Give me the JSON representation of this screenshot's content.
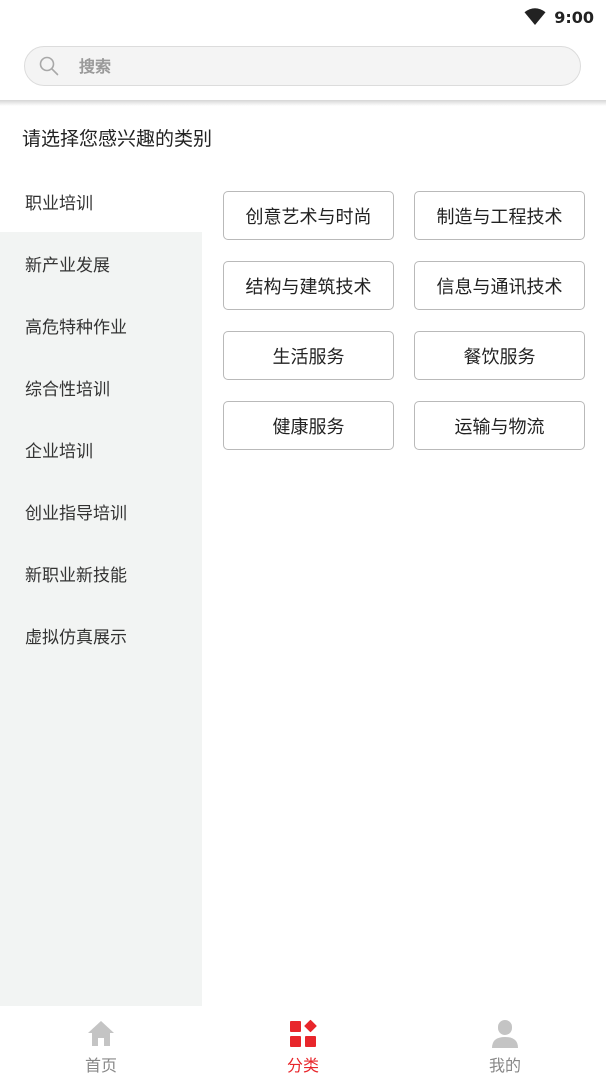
{
  "status_bar": {
    "time": "9:00",
    "wifi_icon": "wifi-icon"
  },
  "search": {
    "placeholder": "搜索",
    "value": "",
    "icon": "search-icon"
  },
  "page_title": "请选择您感兴趣的类别",
  "sidebar": {
    "active_index": 0,
    "items": [
      {
        "label": "职业培训"
      },
      {
        "label": "新产业发展"
      },
      {
        "label": "高危特种作业"
      },
      {
        "label": "综合性培训"
      },
      {
        "label": "企业培训"
      },
      {
        "label": "创业指导培训"
      },
      {
        "label": "新职业新技能"
      },
      {
        "label": "虚拟仿真展示"
      }
    ]
  },
  "categories": [
    {
      "label": "创意艺术与时尚"
    },
    {
      "label": "制造与工程技术"
    },
    {
      "label": "结构与建筑技术"
    },
    {
      "label": "信息与通讯技术"
    },
    {
      "label": "生活服务"
    },
    {
      "label": "餐饮服务"
    },
    {
      "label": "健康服务"
    },
    {
      "label": "运输与物流"
    }
  ],
  "tabbar": {
    "active_index": 1,
    "accent_color": "#e8262b",
    "inactive_color": "#888888",
    "tabs": [
      {
        "label": "首页",
        "icon": "home-icon"
      },
      {
        "label": "分类",
        "icon": "category-icon"
      },
      {
        "label": "我的",
        "icon": "user-icon"
      }
    ]
  }
}
